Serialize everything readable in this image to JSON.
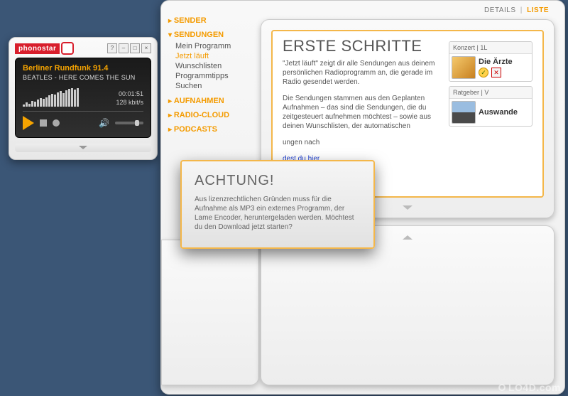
{
  "logo": "phonostar",
  "player": {
    "station": "Berliner Rundfunk 91.4",
    "track": "BEATLES - HERE COMES THE SUN",
    "time": "00:01:51",
    "bitrate": "128 kbit/s",
    "vis_heights": [
      3,
      6,
      4,
      8,
      7,
      10,
      12,
      11,
      13,
      16,
      18,
      17,
      20,
      22,
      19,
      23,
      25,
      26,
      24,
      26
    ]
  },
  "nav": {
    "sender": "SENDER",
    "sendungen": "SENDUNGEN",
    "sub": [
      "Mein Programm",
      "Jetzt läuft",
      "Wunschlisten",
      "Programmtipps",
      "Suchen"
    ],
    "aufnahmen": "AUFNAHMEN",
    "radiocloud": "RADIO-CLOUD",
    "podcasts": "PODCASTS"
  },
  "tabs": {
    "details": "DETAILS",
    "liste": "LISTE"
  },
  "card": {
    "title": "ERSTE SCHRITTE",
    "p1": "\"Jetzt läuft\" zeigt dir alle Sendungen aus deinem persönlichen Radioprogramm an, die gerade im Radio gesendet werden.",
    "p2": "Die Sendungen stammen aus den Geplanten Aufnahmen – das sind die Sendungen, die du zeitgesteuert aufnehmen möchtest – sowie aus deinen Wunschlisten, der automatischen",
    "p3_suffix": "ungen nach",
    "link": "dest du hier",
    "items": [
      {
        "meta": "Konzert | 1L",
        "title": "Die Ärzte"
      },
      {
        "meta": "Ratgeber | V",
        "title": "Auswande"
      }
    ]
  },
  "dialog": {
    "title": "ACHTUNG!",
    "body": "Aus lizenzrechtlichen Gründen muss für die Aufnahme als MP3 ein externes Programm, der Lame Encoder, heruntergeladen werden. Möchtest du den Download jetzt starten?"
  },
  "watermark": "LO4D.com"
}
